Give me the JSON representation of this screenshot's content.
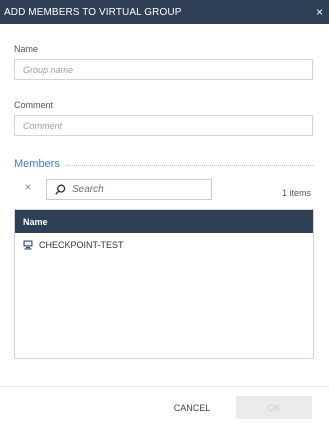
{
  "dialog": {
    "title": "ADD MEMBERS TO VIRTUAL GROUP",
    "close_glyph": "×"
  },
  "form": {
    "name_label": "Name",
    "name_placeholder": "Group name",
    "name_value": "",
    "comment_label": "Comment",
    "comment_placeholder": "Comment",
    "comment_value": ""
  },
  "members": {
    "title": "Members",
    "clear_glyph": "×",
    "search_placeholder": "Search",
    "search_value": "",
    "item_count": "1 items",
    "table": {
      "columns": [
        "Name"
      ],
      "rows": [
        {
          "icon": "gateway-icon",
          "name": "CHECKPOINT-TEST"
        }
      ]
    }
  },
  "footer": {
    "cancel_label": "CANCEL",
    "ok_label": "OK",
    "ok_enabled": false
  },
  "colors": {
    "header_bg": "#2f3f55",
    "accent": "#3d7fc0",
    "disabled_bg": "#e9ebed"
  }
}
